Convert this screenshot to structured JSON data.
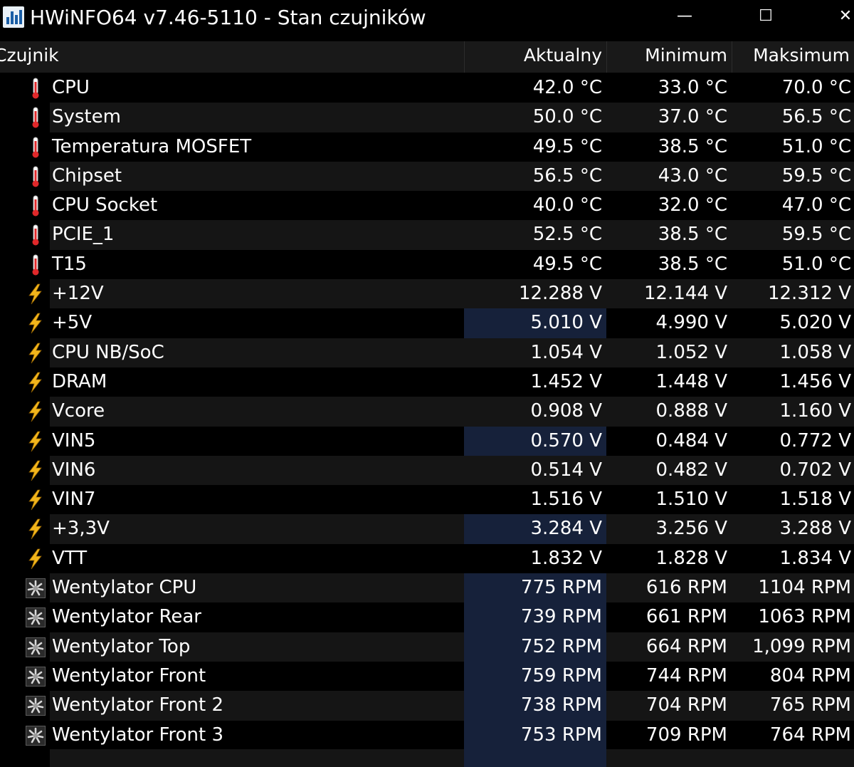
{
  "window": {
    "title": "HWiNFO64 v7.46-5110 - Stan czujników",
    "icon": "hwinfo-app-icon",
    "controls": {
      "minimize": "—",
      "maximize": "☐",
      "close": "✕"
    }
  },
  "columns": {
    "sensor": "Czujnik",
    "current": "Aktualny",
    "minimum": "Minimum",
    "maximum": "Maksimum"
  },
  "colors": {
    "background": "#000000",
    "row_alt": "#151515",
    "highlight": "#16213a",
    "thermometer": "#e0282a",
    "bolt": "#f2b51b"
  },
  "rows": [
    {
      "icon": "thermometer-icon",
      "name": "CPU",
      "current": "42.0 °C",
      "min": "33.0 °C",
      "max": "70.0 °C",
      "highlight": false
    },
    {
      "icon": "thermometer-icon",
      "name": "System",
      "current": "50.0 °C",
      "min": "37.0 °C",
      "max": "56.5 °C",
      "highlight": false
    },
    {
      "icon": "thermometer-icon",
      "name": "Temperatura MOSFET",
      "current": "49.5 °C",
      "min": "38.5 °C",
      "max": "51.0 °C",
      "highlight": false
    },
    {
      "icon": "thermometer-icon",
      "name": "Chipset",
      "current": "56.5 °C",
      "min": "43.0 °C",
      "max": "59.5 °C",
      "highlight": false
    },
    {
      "icon": "thermometer-icon",
      "name": "CPU Socket",
      "current": "40.0 °C",
      "min": "32.0 °C",
      "max": "47.0 °C",
      "highlight": false
    },
    {
      "icon": "thermometer-icon",
      "name": "PCIE_1",
      "current": "52.5 °C",
      "min": "38.5 °C",
      "max": "59.5 °C",
      "highlight": false
    },
    {
      "icon": "thermometer-icon",
      "name": "T15",
      "current": "49.5 °C",
      "min": "38.5 °C",
      "max": "51.0 °C",
      "highlight": false
    },
    {
      "icon": "lightning-bolt-icon",
      "name": "+12V",
      "current": "12.288 V",
      "min": "12.144 V",
      "max": "12.312 V",
      "highlight": false
    },
    {
      "icon": "lightning-bolt-icon",
      "name": "+5V",
      "current": "5.010 V",
      "min": "4.990 V",
      "max": "5.020 V",
      "highlight": true
    },
    {
      "icon": "lightning-bolt-icon",
      "name": "CPU NB/SoC",
      "current": "1.054 V",
      "min": "1.052 V",
      "max": "1.058 V",
      "highlight": false
    },
    {
      "icon": "lightning-bolt-icon",
      "name": "DRAM",
      "current": "1.452 V",
      "min": "1.448 V",
      "max": "1.456 V",
      "highlight": false
    },
    {
      "icon": "lightning-bolt-icon",
      "name": "Vcore",
      "current": "0.908 V",
      "min": "0.888 V",
      "max": "1.160 V",
      "highlight": false
    },
    {
      "icon": "lightning-bolt-icon",
      "name": "VIN5",
      "current": "0.570 V",
      "min": "0.484 V",
      "max": "0.772 V",
      "highlight": true
    },
    {
      "icon": "lightning-bolt-icon",
      "name": "VIN6",
      "current": "0.514 V",
      "min": "0.482 V",
      "max": "0.702 V",
      "highlight": false
    },
    {
      "icon": "lightning-bolt-icon",
      "name": "VIN7",
      "current": "1.516 V",
      "min": "1.510 V",
      "max": "1.518 V",
      "highlight": false
    },
    {
      "icon": "lightning-bolt-icon",
      "name": "+3,3V",
      "current": "3.284 V",
      "min": "3.256 V",
      "max": "3.288 V",
      "highlight": true
    },
    {
      "icon": "lightning-bolt-icon",
      "name": "VTT",
      "current": "1.832 V",
      "min": "1.828 V",
      "max": "1.834 V",
      "highlight": false
    },
    {
      "icon": "fan-icon",
      "name": "Wentylator CPU",
      "current": "775 RPM",
      "min": "616 RPM",
      "max": "1104 RPM",
      "highlight": true
    },
    {
      "icon": "fan-icon",
      "name": "Wentylator Rear",
      "current": "739 RPM",
      "min": "661 RPM",
      "max": "1063 RPM",
      "highlight": true
    },
    {
      "icon": "fan-icon",
      "name": "Wentylator Top",
      "current": "752 RPM",
      "min": "664 RPM",
      "max": "1,099 RPM",
      "highlight": true
    },
    {
      "icon": "fan-icon",
      "name": "Wentylator Front",
      "current": "759 RPM",
      "min": "744 RPM",
      "max": "804 RPM",
      "highlight": true
    },
    {
      "icon": "fan-icon",
      "name": "Wentylator Front 2",
      "current": "738 RPM",
      "min": "704 RPM",
      "max": "765 RPM",
      "highlight": true
    },
    {
      "icon": "fan-icon",
      "name": "Wentylator Front 3",
      "current": "753 RPM",
      "min": "709 RPM",
      "max": "764 RPM",
      "highlight": true
    }
  ]
}
